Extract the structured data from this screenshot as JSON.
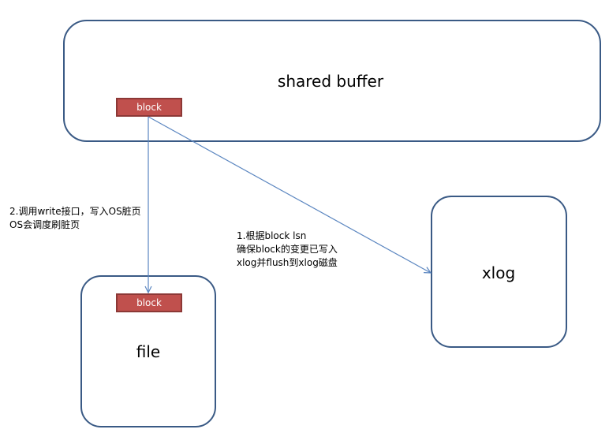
{
  "shared_buffer": {
    "title": "shared buffer",
    "block_label": "block"
  },
  "xlog": {
    "title": "xlog"
  },
  "file": {
    "title": "file",
    "block_label": "block"
  },
  "note_write": {
    "line1": "2.调用write接口，写入OS脏页",
    "line2": "OS会调度刷脏页"
  },
  "note_flush": {
    "line1": "1.根据block lsn",
    "line2": "确保block的变更已写入",
    "line3": "xlog并flush到xlog磁盘"
  },
  "colors": {
    "box_border": "#3a5a85",
    "block_fill": "#c0504d",
    "arrow": "#5b86c0"
  }
}
